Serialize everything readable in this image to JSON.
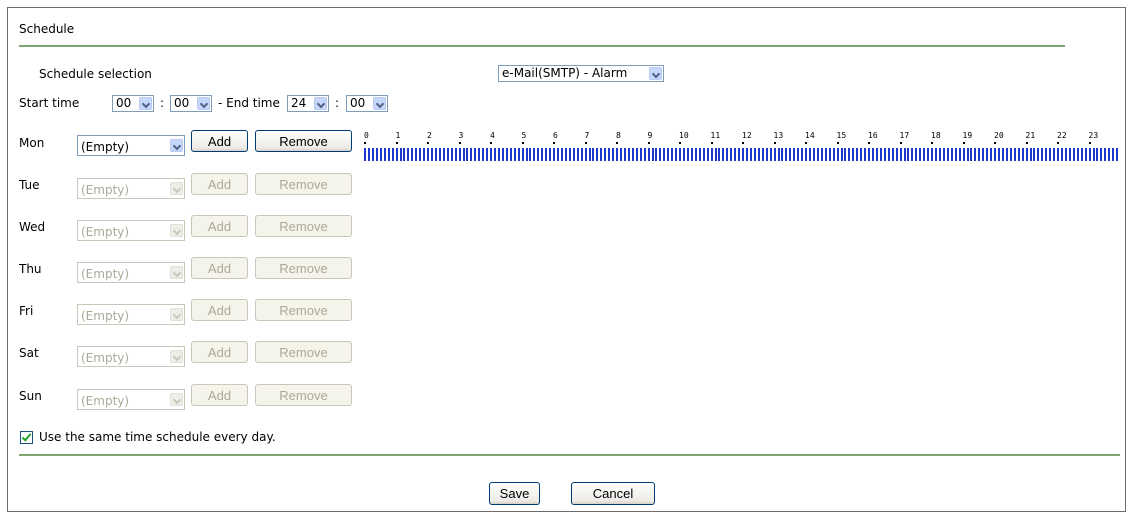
{
  "section_title": "Schedule",
  "schedule_selection": {
    "label": "Schedule selection",
    "value": "e-Mail(SMTP) - Alarm"
  },
  "time_range": {
    "start_label": "Start time",
    "start_hour": "00",
    "start_minute": "00",
    "separator": ":",
    "end_label": "- End time",
    "end_hour": "24",
    "end_minute": "00"
  },
  "days": [
    {
      "label": "Mon",
      "select_value": "(Empty)",
      "add_label": "Add",
      "remove_label": "Remove",
      "enabled": true
    },
    {
      "label": "Tue",
      "select_value": "(Empty)",
      "add_label": "Add",
      "remove_label": "Remove",
      "enabled": false
    },
    {
      "label": "Wed",
      "select_value": "(Empty)",
      "add_label": "Add",
      "remove_label": "Remove",
      "enabled": false
    },
    {
      "label": "Thu",
      "select_value": "(Empty)",
      "add_label": "Add",
      "remove_label": "Remove",
      "enabled": false
    },
    {
      "label": "Fri",
      "select_value": "(Empty)",
      "add_label": "Add",
      "remove_label": "Remove",
      "enabled": false
    },
    {
      "label": "Sat",
      "select_value": "(Empty)",
      "add_label": "Add",
      "remove_label": "Remove",
      "enabled": false
    },
    {
      "label": "Sun",
      "select_value": "(Empty)",
      "add_label": "Add",
      "remove_label": "Remove",
      "enabled": false
    }
  ],
  "timeline": {
    "hours": [
      "0",
      "1",
      "2",
      "3",
      "4",
      "5",
      "6",
      "7",
      "8",
      "9",
      "10",
      "11",
      "12",
      "13",
      "14",
      "15",
      "16",
      "17",
      "18",
      "19",
      "20",
      "21",
      "22",
      "23"
    ],
    "active_fraction": 1.0
  },
  "same_schedule": {
    "checked": true,
    "label": "Use the same time schedule every day."
  },
  "actions": {
    "save_label": "Save",
    "cancel_label": "Cancel"
  },
  "colors": {
    "divider": "#7da56d",
    "timeline_slot": "#1c36c9",
    "disabled_text": "#aca899"
  }
}
